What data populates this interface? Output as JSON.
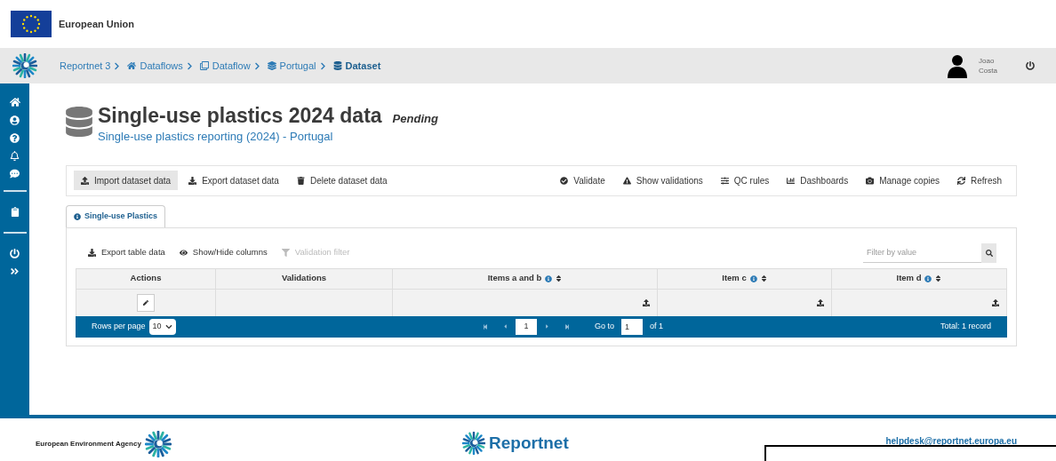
{
  "header": {
    "title": "European Union"
  },
  "breadcrumbs": [
    {
      "label": "Reportnet 3",
      "kind": "text",
      "current": false
    },
    {
      "label": "Dataflows",
      "kind": "home",
      "current": false
    },
    {
      "label": "Dataflow",
      "kind": "clone",
      "current": false
    },
    {
      "label": "Portugal",
      "kind": "stack",
      "current": false
    },
    {
      "label": "Dataset",
      "kind": "database",
      "current": true
    }
  ],
  "user": {
    "first_name": "Joao",
    "last_name": "Costa"
  },
  "dataset": {
    "title": "Single-use plastics 2024 data",
    "status": "Pending",
    "subtitle": "Single-use plastics reporting (2024) - Portugal"
  },
  "toolbar": {
    "left": [
      {
        "label": "Import dataset data",
        "kind": "import",
        "selected": true
      },
      {
        "label": "Export dataset data",
        "kind": "export",
        "selected": false
      },
      {
        "label": "Delete dataset data",
        "kind": "delete",
        "selected": false
      }
    ],
    "right": [
      {
        "label": "Validate",
        "kind": "validate",
        "selected": false
      },
      {
        "label": "Show validations",
        "kind": "warning",
        "selected": false
      },
      {
        "label": "QC rules",
        "kind": "sliders",
        "selected": false
      },
      {
        "label": "Dashboards",
        "kind": "chart",
        "selected": false
      },
      {
        "label": "Manage copies",
        "kind": "camera",
        "selected": false
      },
      {
        "label": "Refresh",
        "kind": "refresh",
        "selected": false
      }
    ]
  },
  "tabs": [
    {
      "label": "Single-use Plastics",
      "selected": true
    }
  ],
  "table_toolbar": {
    "actions": [
      {
        "label": "Export table data",
        "kind": "export",
        "disabled": false
      },
      {
        "label": "Show/Hide columns",
        "kind": "eye",
        "disabled": false
      },
      {
        "label": "Validation filter",
        "kind": "filter",
        "disabled": true
      }
    ],
    "filter_placeholder": "Filter by value"
  },
  "table": {
    "columns": [
      {
        "label": "Actions",
        "info": false,
        "sortable": false
      },
      {
        "label": "Validations",
        "info": false,
        "sortable": false
      },
      {
        "label": "Items a and b",
        "info": true,
        "sortable": true
      },
      {
        "label": "Item c",
        "info": true,
        "sortable": true
      },
      {
        "label": "Item d",
        "info": true,
        "sortable": true
      }
    ],
    "rows": [
      {
        "cells": [
          {
            "kind": "edit"
          },
          {
            "kind": "empty"
          },
          {
            "kind": "upload"
          },
          {
            "kind": "upload"
          },
          {
            "kind": "upload"
          }
        ]
      }
    ]
  },
  "paginator": {
    "rows_per_page_label": "Rows per page",
    "rows_per_page": "10",
    "page": "1",
    "go_to_label": "Go to",
    "go_to_value": "1",
    "of_label": "of 1",
    "total": "Total: 1 record"
  },
  "footer": {
    "agency": "European Environment Agency",
    "brand": "Reportnet",
    "email": "helpdesk@reportnet.europa.eu"
  }
}
